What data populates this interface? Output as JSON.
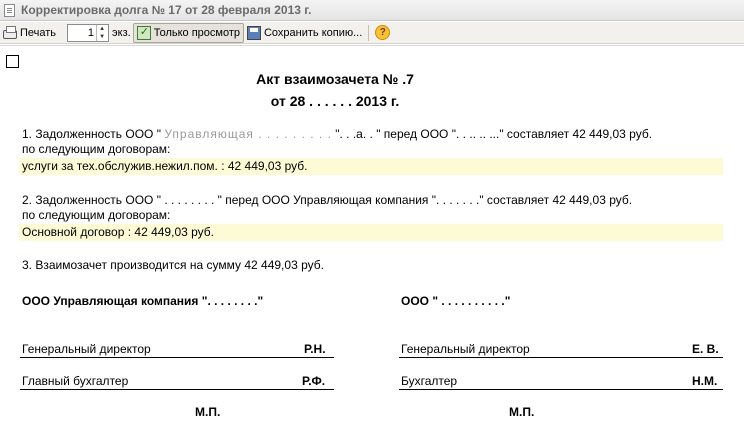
{
  "window": {
    "title": "Корректировка долга № 17 от 28 февраля 2013 г."
  },
  "toolbar": {
    "print_label": "Печать",
    "copies_value": "1",
    "copies_unit": "экз.",
    "readonly_label": "Только просмотр",
    "save_copy_label": "Сохранить копию...",
    "help_glyph": "?"
  },
  "document": {
    "title_line1": "Акт взаимозачета № .7",
    "title_line2": "от 28 . . . . . . 2013 г.",
    "p1_line1_a": "1. Задолженность ООО \" ",
    "p1_line1_blur": "Управляющая . . . . . . . . .",
    "p1_line1_b": " \". . .а. . \" перед ООО \". . .. .. ...\" составляет 42 449,03 руб.",
    "p1_line2": "по следующим договорам:",
    "p1_contract": "услуги за тех.обслужив.нежил.пом. : 42 449,03 руб.",
    "p2_line1": "2. Задолженность ООО \" . . . . . . . . \" перед ООО Управляющая компания \". . . . . . .\" составляет 42 449,03 руб.",
    "p2_line2": "по следующим договорам:",
    "p2_contract": "Основной договор :  42 449,03 руб.",
    "p3": "3. Взаимозачет производится на сумму 42 449,03 руб.",
    "left_party": "ООО Управляющая компания \". . . . . . . .\"",
    "right_party": "ООО \" . . . . . . . . . .\"",
    "left_director_label": "Генеральный директор",
    "left_director_name": "Р.Н.",
    "left_accountant_label": "Главный бухгалтер",
    "left_accountant_name": "Р.Ф.",
    "right_director_label": "Генеральный директор",
    "right_director_name": "Е. В.",
    "right_accountant_label": "Бухгалтер",
    "right_accountant_name": "Н.М.",
    "stamp_label": "М.П."
  }
}
